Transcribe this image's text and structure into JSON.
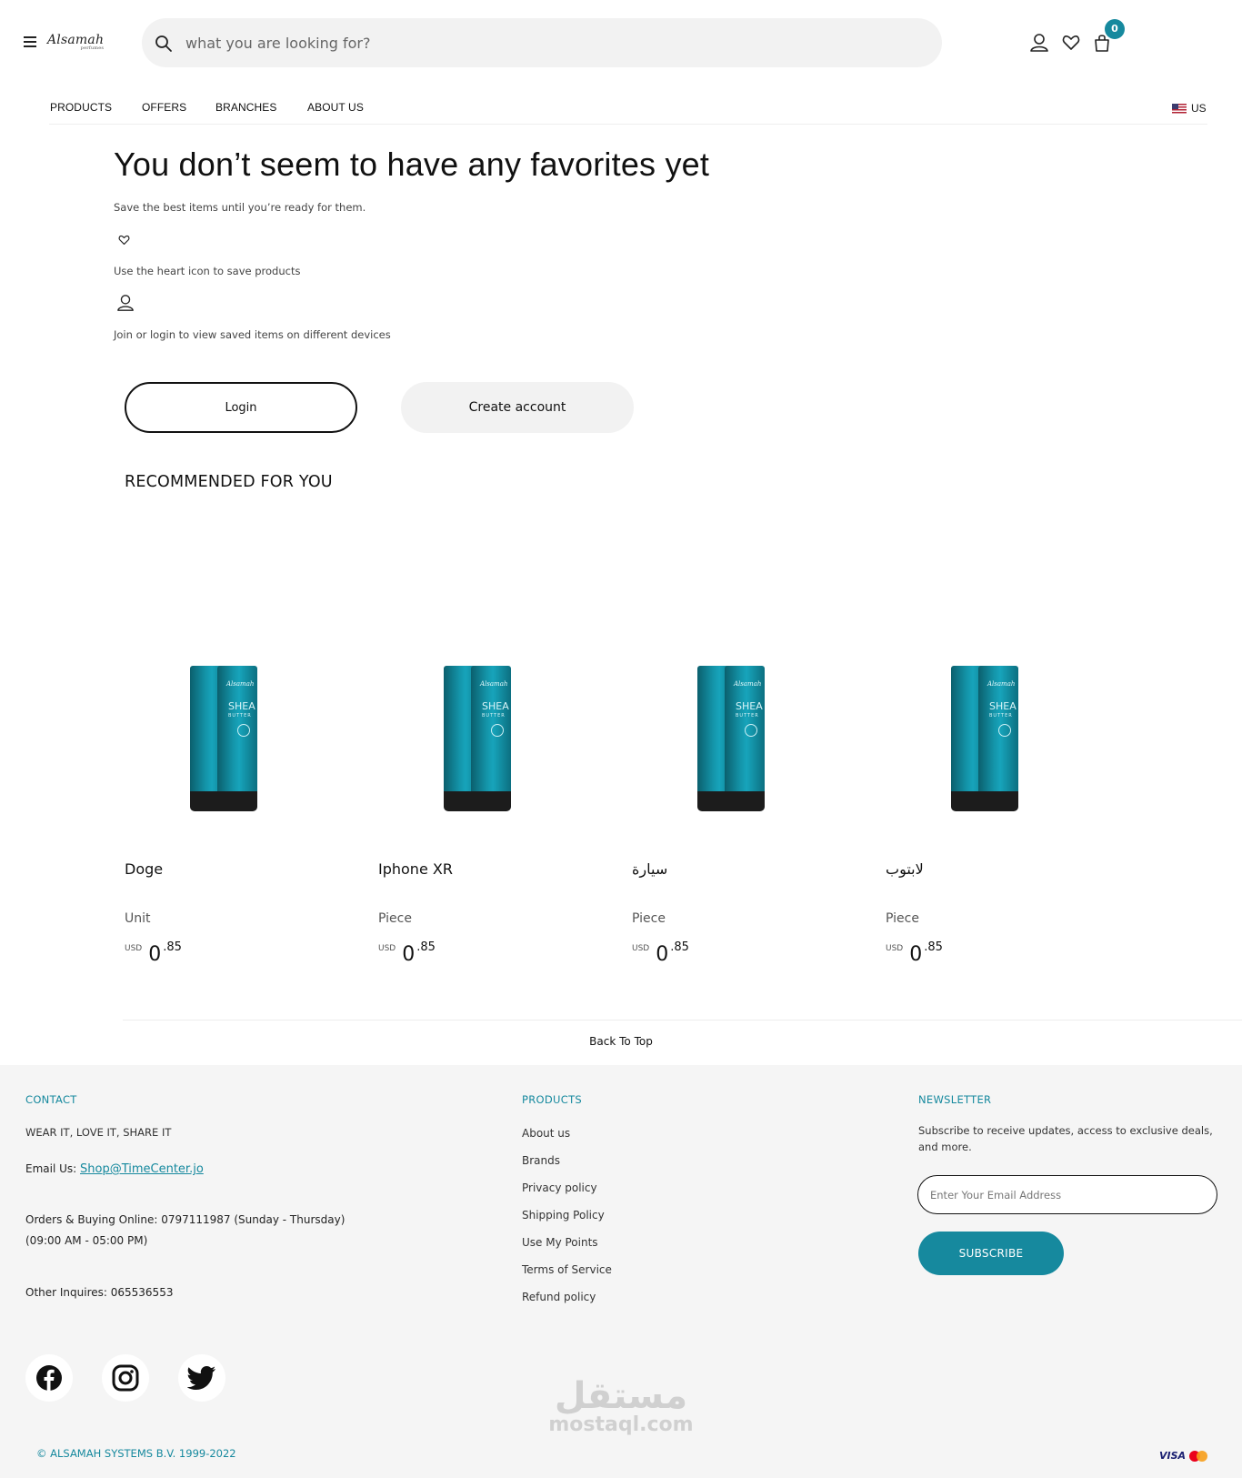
{
  "header": {
    "logo": "Alsamah",
    "logo_sub": "perfumes",
    "search_placeholder": "what you are looking for?",
    "cart_count": "0",
    "nav": [
      "PRODUCTS",
      "OFFERS",
      "BRANCHES",
      "ABOUT US"
    ],
    "locale": "US"
  },
  "main": {
    "headline": "You don’t seem to have any favorites yet",
    "subtitle": "Save the best items until you’re ready for them.",
    "tip_heart": "Use the heart icon to save products",
    "tip_login": "Join or login to view saved items on different devices",
    "login_label": "Login",
    "create_label": "Create account",
    "recommended_title": "RECOMMENDED FOR YOU"
  },
  "products": [
    {
      "name": "Doge",
      "unit": "Unit",
      "currency": "USD",
      "price_int": "0",
      "price_dec": ".85"
    },
    {
      "name": "Iphone XR",
      "unit": "Piece",
      "currency": "USD",
      "price_int": "0",
      "price_dec": ".85"
    },
    {
      "name": "سيارة",
      "unit": "Piece",
      "currency": "USD",
      "price_int": "0",
      "price_dec": ".85"
    },
    {
      "name": "لابتوب",
      "unit": "Piece",
      "currency": "USD",
      "price_int": "0",
      "price_dec": ".85"
    }
  ],
  "product_image": {
    "brand": "Alsamah",
    "label": "SHEA",
    "label2": "BUTTER"
  },
  "back_to_top": "Back To Top",
  "footer": {
    "contact_head": "CONTACT",
    "tagline": "WEAR IT, LOVE IT, SHARE IT",
    "email_label": "Email Us: ",
    "email": "Shop@TimeCenter.jo",
    "orders": "Orders & Buying Online: 0797111987 (Sunday - Thursday) (09:00 AM - 05:00 PM)",
    "other": "Other Inquires: 065536553",
    "products_head": "PRODUCTS",
    "links": [
      "About us",
      "Brands",
      "Privacy policy",
      "Shipping Policy",
      "Use My Points",
      "Terms of Service",
      "Refund policy"
    ],
    "newsletter_head": "NEWSLETTER",
    "newsletter_text": "Subscribe to receive updates, access to exclusive deals, and more.",
    "email_placeholder": "Enter Your Email Address",
    "subscribe_label": "SUBSCRIBE",
    "social": [
      "facebook-icon",
      "instagram-icon",
      "twitter-icon"
    ],
    "copyright": "© ALSAMAH SYSTEMS B.V. 1999-2022",
    "payment": "VISA"
  },
  "watermark": {
    "arabic": "مستقل",
    "latin": "mostaql.com"
  },
  "colors": {
    "accent": "#16899e",
    "footer_bg": "#f5f5f5",
    "pill_bg": "#f2f2f2"
  }
}
